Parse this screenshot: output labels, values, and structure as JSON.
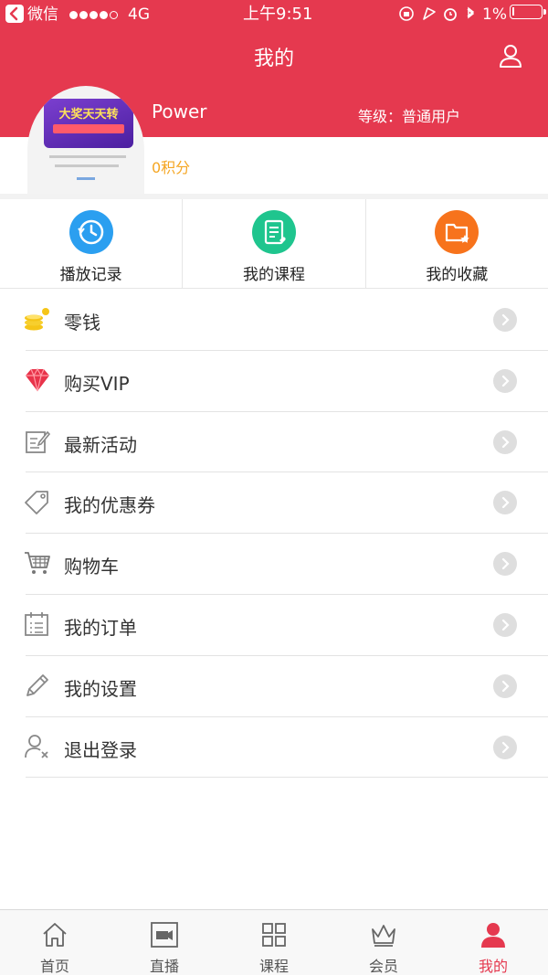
{
  "status_bar": {
    "carrier": "微信",
    "network": "4G",
    "time": "上午9:51",
    "battery": "1%"
  },
  "header": {
    "title": "我的"
  },
  "profile": {
    "username": "Power",
    "level": "等级：普通用户",
    "points": "0积分",
    "avatar_banner_text": "大奖天天转"
  },
  "quick_actions": [
    {
      "label": "播放记录",
      "icon": "history-icon",
      "color": "#2b9ff0"
    },
    {
      "label": "我的课程",
      "icon": "course-doc-icon",
      "color": "#1fc58e"
    },
    {
      "label": "我的收藏",
      "icon": "favorite-folder-icon",
      "color": "#f7731c"
    }
  ],
  "menu": [
    {
      "label": "零钱",
      "icon": "coins-icon"
    },
    {
      "label": "购买VIP",
      "icon": "diamond-icon"
    },
    {
      "label": "最新活动",
      "icon": "edit-note-icon"
    },
    {
      "label": "我的优惠券",
      "icon": "tag-icon"
    },
    {
      "label": "购物车",
      "icon": "cart-icon"
    },
    {
      "label": "我的订单",
      "icon": "order-list-icon"
    },
    {
      "label": "我的设置",
      "icon": "pencil-icon"
    },
    {
      "label": "退出登录",
      "icon": "logout-user-icon"
    }
  ],
  "tabs": [
    {
      "label": "首页",
      "icon": "home-icon",
      "active": false
    },
    {
      "label": "直播",
      "icon": "live-camera-icon",
      "active": false
    },
    {
      "label": "课程",
      "icon": "grid-icon",
      "active": false
    },
    {
      "label": "会员",
      "icon": "crown-icon",
      "active": false
    },
    {
      "label": "我的",
      "icon": "profile-icon",
      "active": true
    }
  ],
  "colors": {
    "brand_red": "#e5394f",
    "points_orange": "#f5a623",
    "vip_red": "#e8334a",
    "coin_yellow": "#f5c518"
  }
}
